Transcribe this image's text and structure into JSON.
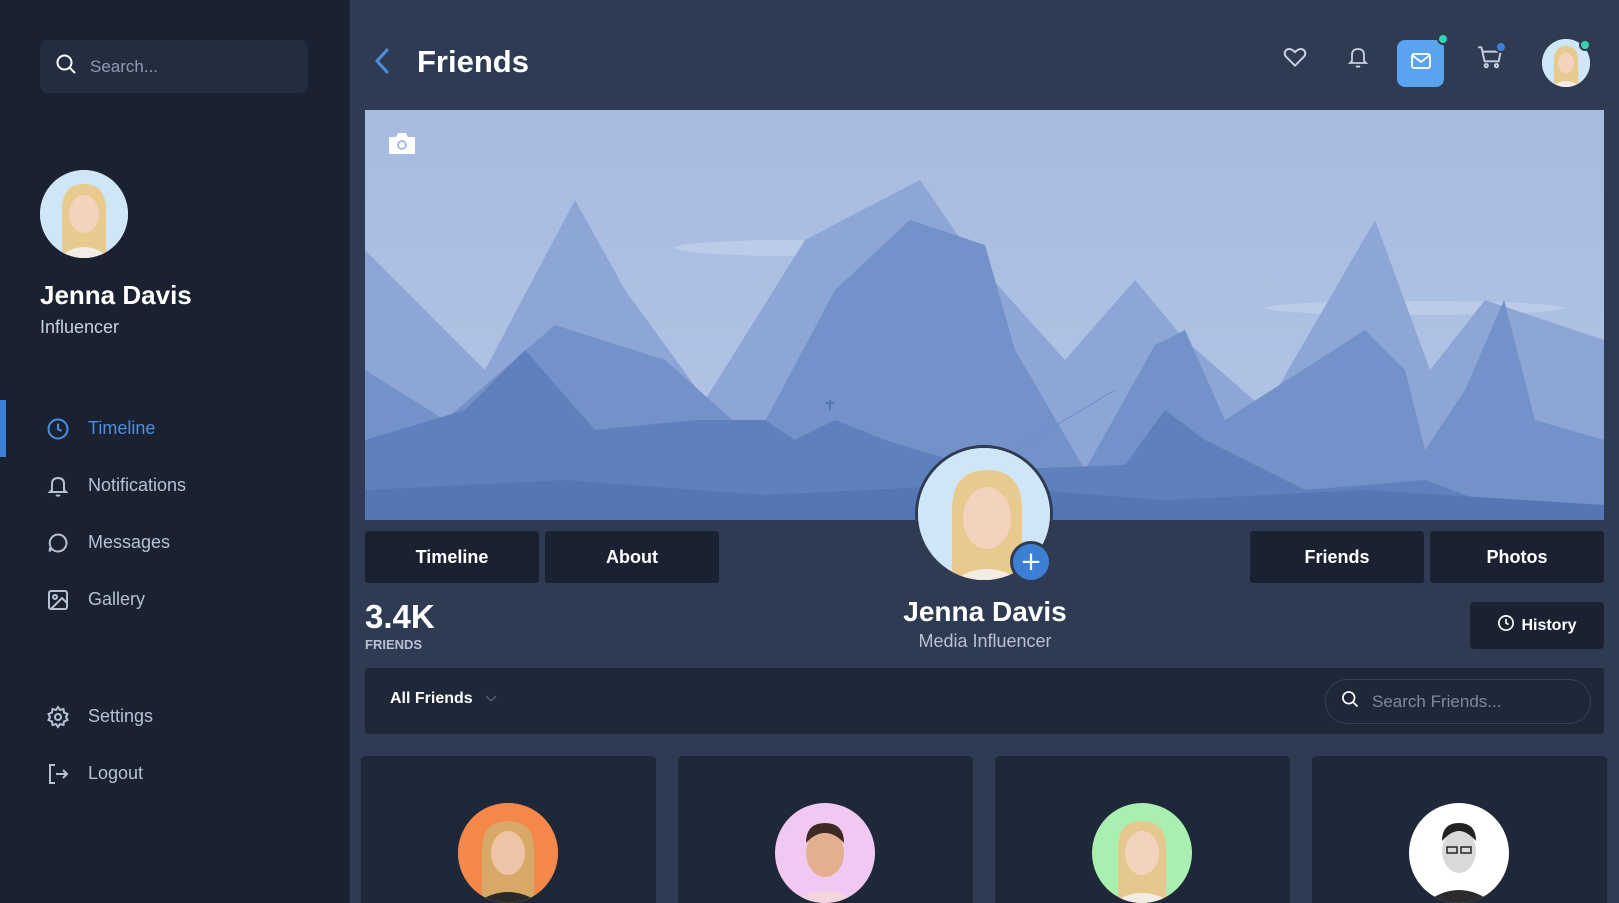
{
  "sidebar": {
    "search_placeholder": "Search...",
    "profile": {
      "name": "Jenna Davis",
      "role": "Influencer"
    },
    "nav": [
      {
        "label": "Timeline",
        "icon": "clock-icon",
        "active": true
      },
      {
        "label": "Notifications",
        "icon": "bell-icon"
      },
      {
        "label": "Messages",
        "icon": "message-icon"
      },
      {
        "label": "Gallery",
        "icon": "image-icon"
      }
    ],
    "bottom_nav": [
      {
        "label": "Settings",
        "icon": "gear-icon"
      },
      {
        "label": "Logout",
        "icon": "logout-icon"
      }
    ]
  },
  "header": {
    "title": "Friends",
    "icons": [
      "heart-icon",
      "bell-icon",
      "mail-icon",
      "cart-icon"
    ],
    "colors": {
      "accent": "#5aa3ee",
      "online_dot": "#36d3b0",
      "cart_dot": "#3e7fd6"
    }
  },
  "profile_header": {
    "tabs_left": [
      "Timeline",
      "About"
    ],
    "tabs_right": [
      "Friends",
      "Photos"
    ],
    "name": "Jenna Davis",
    "role": "Media Influencer",
    "friends_count": "3.4K",
    "friends_label": "FRIENDS",
    "history_label": "History",
    "add_symbol": "+"
  },
  "filter": {
    "selected": "All Friends",
    "search_placeholder": "Search Friends..."
  },
  "friends": [
    {
      "avatar_bg": "#f4874a"
    },
    {
      "avatar_bg": "#f0c8f2"
    },
    {
      "avatar_bg": "#a9f0b0"
    },
    {
      "avatar_bg": "#ffffff"
    }
  ],
  "colors": {
    "sidebar_bg": "#1a2232",
    "main_bg": "#2f3b52",
    "active": "#4a8fe0",
    "cover_sky": "#a9bde0"
  }
}
